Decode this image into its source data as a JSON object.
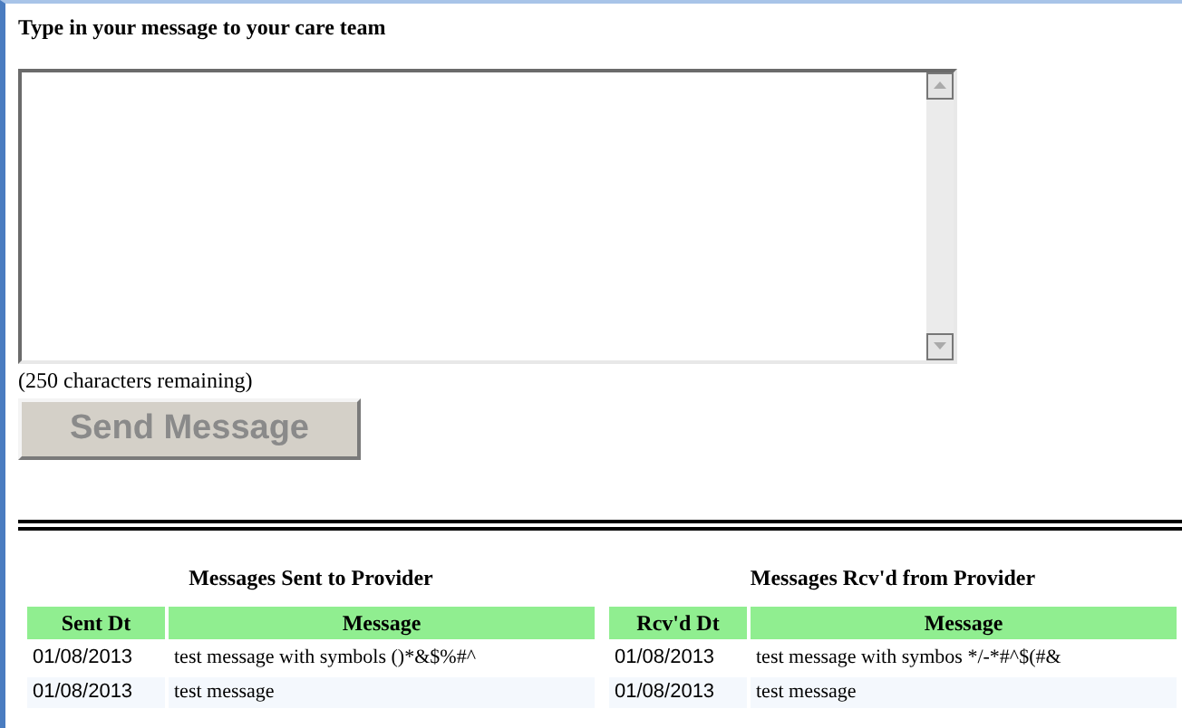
{
  "compose": {
    "label": "Type in your message to your care team",
    "remaining": "(250 characters remaining)",
    "send_button": {
      "label": "Send Message",
      "disabled": true
    }
  },
  "tables": [
    {
      "title": "Messages Sent to Provider",
      "columns": [
        "Sent Dt",
        "Message"
      ],
      "rows": [
        {
          "date": "01/08/2013",
          "message": "test message with symbols ()*&$%#^"
        },
        {
          "date": "01/08/2013",
          "message": "test message"
        }
      ]
    },
    {
      "title": "Messages Rcv'd from Provider",
      "columns": [
        "Rcv'd Dt",
        "Message"
      ],
      "rows": [
        {
          "date": "01/08/2013",
          "message": "test message with symbos */-*#^$(#&"
        },
        {
          "date": "01/08/2013",
          "message": "test message"
        }
      ]
    }
  ]
}
